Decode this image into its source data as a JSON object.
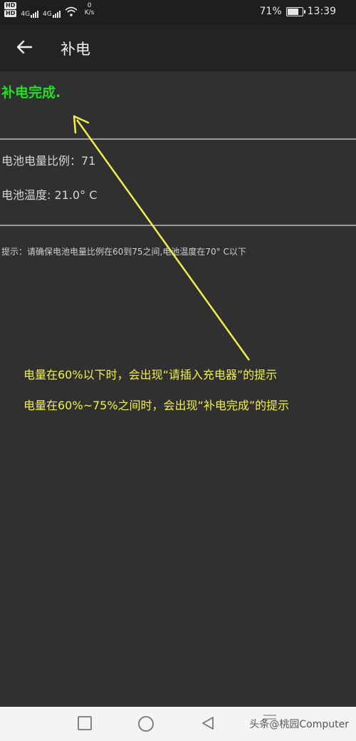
{
  "status_bar": {
    "hd1": "HD",
    "hd2": "HD",
    "net1": "4G",
    "net2": "4G",
    "speed_value": "0",
    "speed_unit": "K/s",
    "battery_percent": "71%",
    "battery_level": 0.71,
    "time": "13:39"
  },
  "app_bar": {
    "title": "补电"
  },
  "content": {
    "status_message": "补电完成.",
    "battery_ratio": "电池电量比例：71",
    "battery_temp": "电池温度: 21.0° C",
    "tip": "提示：请确保电池电量比例在60到75之间,电池温度在70° C以下"
  },
  "annotation": {
    "line1": "电量在60%以下时，会出现“请插入充电器”的提示",
    "line2": "电量在60%~75%之间时，会出现“补电完成”的提示",
    "color": "#f1f04a"
  },
  "nav_bar": {
    "watermark": "头条@桃园Computer"
  },
  "colors": {
    "background": "#303030",
    "app_bar": "#232323",
    "success_text": "#22dd22"
  }
}
